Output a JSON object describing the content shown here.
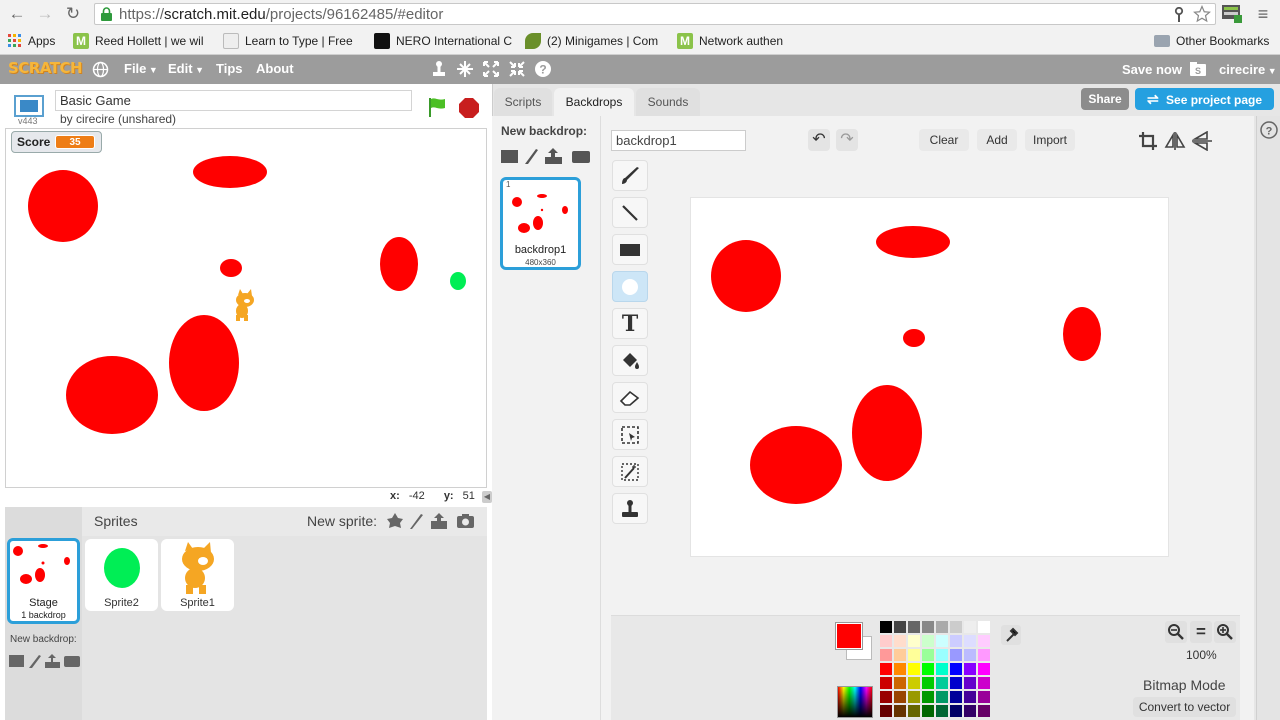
{
  "browser": {
    "url_scheme": "https://",
    "url_host": "scratch.mit.edu",
    "url_path": "/projects/96162485/#editor",
    "bookmarks": [
      {
        "label": "Apps",
        "color": "#e44"
      },
      {
        "label": "Reed Hollett | we wil",
        "color": "#8bc34a"
      },
      {
        "label": "Learn to Type | Free",
        "color": "#bbb"
      },
      {
        "label": "NERO International C",
        "color": "#111"
      },
      {
        "label": "(2) Minigames | Com",
        "color": "#6a8f2a"
      },
      {
        "label": "Network authen",
        "color": "#8bc34a"
      }
    ],
    "other_bookmarks": "Other Bookmarks"
  },
  "menubar": {
    "logo": "SCRATCH",
    "file": "File",
    "edit": "Edit",
    "tips": "Tips",
    "about": "About",
    "save_now": "Save now",
    "username": "cirecire"
  },
  "stage": {
    "version": "v443",
    "project_title": "Basic Game",
    "byline": "by cirecire (unshared)",
    "score_label": "Score",
    "score_value": "35",
    "x_label": "x:",
    "x_value": "-42",
    "y_label": "y:",
    "y_value": "51"
  },
  "sprites": {
    "header": "Sprites",
    "new_sprite": "New sprite:",
    "stage_name": "Stage",
    "stage_sub": "1 backdrop",
    "new_backdrop": "New backdrop:",
    "items": [
      {
        "name": "Sprite2"
      },
      {
        "name": "Sprite1"
      }
    ]
  },
  "editor": {
    "tabs": [
      "Scripts",
      "Backdrops",
      "Sounds"
    ],
    "share": "Share",
    "see_project_page": "See project page",
    "new_backdrop": "New backdrop:",
    "backdrop_index": "1",
    "backdrop_name": "backdrop1",
    "backdrop_size": "480x360",
    "name_field": "backdrop1",
    "clear": "Clear",
    "add": "Add",
    "import": "Import",
    "zoom": "100%",
    "mode": "Bitmap Mode",
    "convert": "Convert to vector",
    "primary_color": "#ff0000"
  },
  "colors": {
    "menubar": "#9c9c9c",
    "blue": "#25a0e0",
    "red": "#ff0000",
    "green": "#00ee55"
  }
}
